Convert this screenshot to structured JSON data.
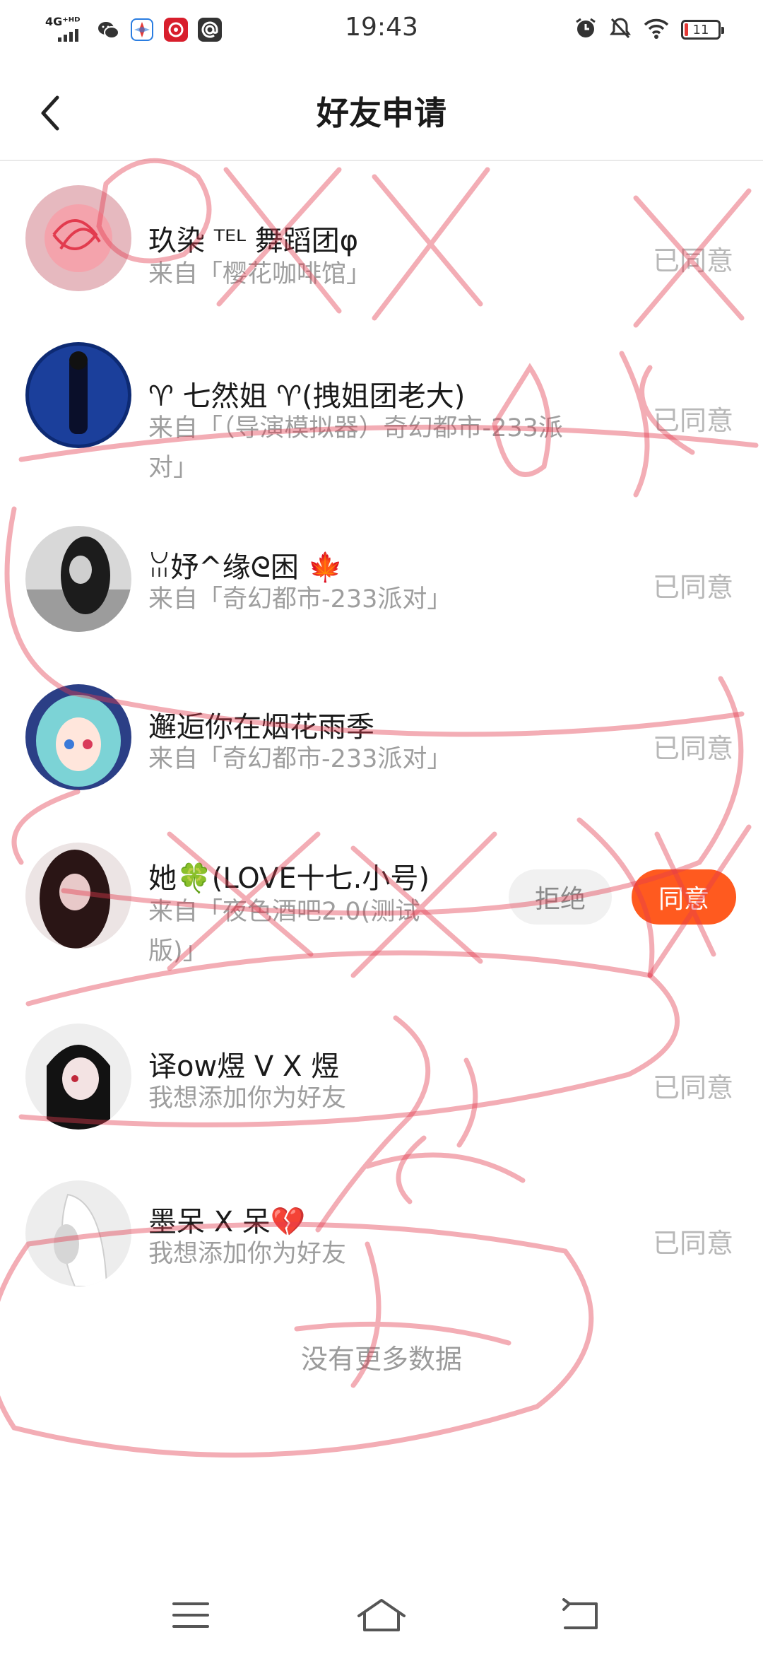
{
  "status_bar": {
    "network": "4G⁺ᴴᴰ",
    "time": "19:43",
    "battery": "11",
    "apps": [
      "wechat-icon",
      "compass-icon",
      "app-red-icon",
      "at-icon"
    ]
  },
  "header": {
    "title": "好友申请"
  },
  "requests": [
    {
      "name": "玖染 ᵀᴱᴸ 舞蹈团φ",
      "source": "来自「樱花咖啡馆」",
      "status": "已同意"
    },
    {
      "name": "♈ 七然姐 ♈(拽姐团老大)",
      "source_line1": "来自「（导演模拟器）奇幻都市-233派",
      "source_line2": "对」",
      "status": "已同意"
    },
    {
      "name": "ꈍ妤^缘ᘓ困 🍁",
      "source": "来自「奇幻都市-233派对」",
      "status": "已同意"
    },
    {
      "name": "邂逅你在烟花雨季",
      "source": "来自「奇幻都市-233派对」",
      "status": "已同意"
    },
    {
      "name": "她🍀(LOVE十七.小号)",
      "source_line1": "来自「夜色酒吧2.0(测试",
      "source_line2": "版)」",
      "reject_label": "拒绝",
      "accept_label": "同意"
    },
    {
      "name": "译ow煜 V X 煜",
      "source": "我想添加你为好友",
      "status": "已同意"
    },
    {
      "name": "墨呆 X 呆💔",
      "source": "我想添加你为好友",
      "status": "已同意"
    }
  ],
  "footer": {
    "no_more": "没有更多数据"
  },
  "colors": {
    "accent": "#ff5a1f",
    "muted_text": "#9e9e9e",
    "scribble": "#e23b4e"
  }
}
